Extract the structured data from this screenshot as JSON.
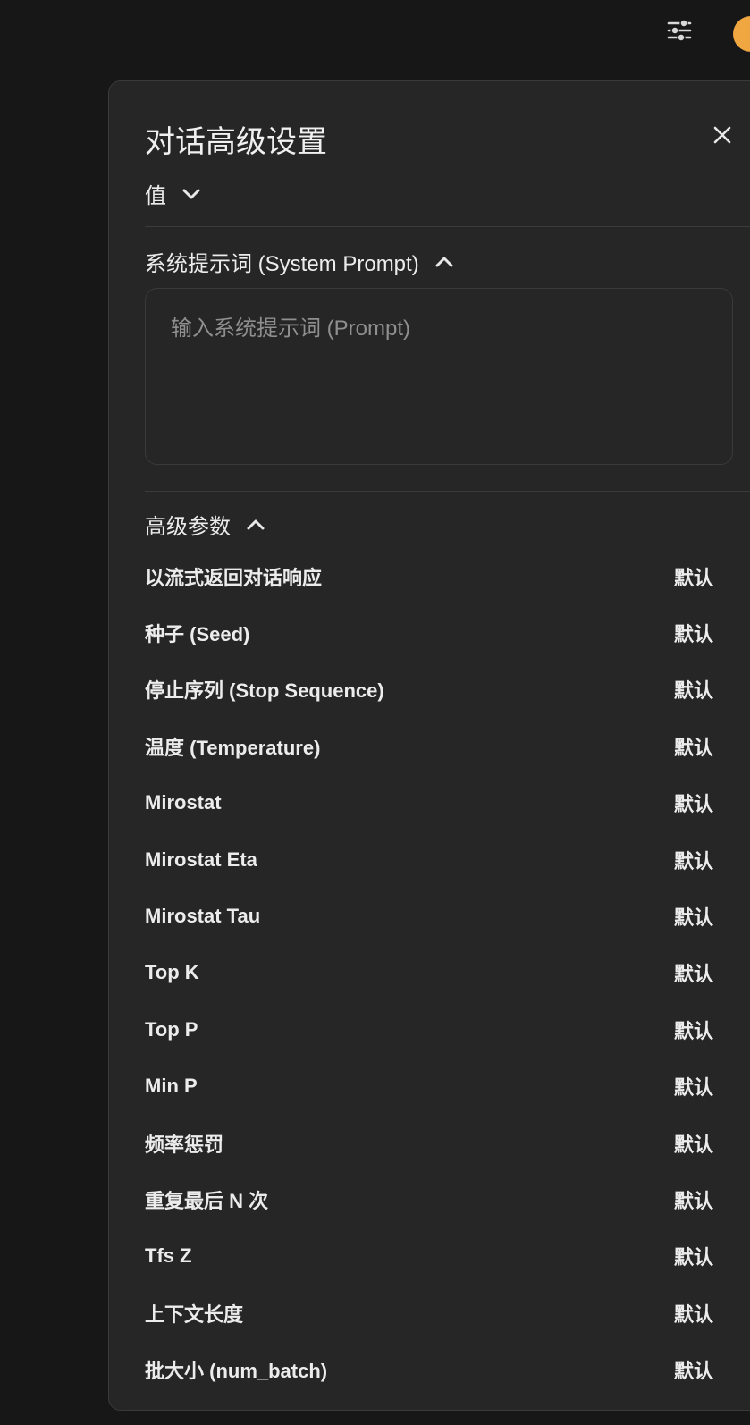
{
  "header": {
    "controls_icon": "sliders-icon",
    "avatar_color": "#f0a742"
  },
  "panel": {
    "title": "对话高级设置",
    "close_icon": "close-icon",
    "valves": {
      "label": "值",
      "icon": "chevron-down-icon"
    },
    "system_prompt": {
      "label": "系统提示词 (System Prompt)",
      "icon": "chevron-up-icon",
      "placeholder": "输入系统提示词 (Prompt)",
      "value": ""
    },
    "advanced": {
      "label": "高级参数",
      "icon": "chevron-up-icon",
      "params": [
        {
          "label": "以流式返回对话响应",
          "value": "默认"
        },
        {
          "label": "种子 (Seed)",
          "value": "默认"
        },
        {
          "label": "停止序列 (Stop Sequence)",
          "value": "默认"
        },
        {
          "label": "温度 (Temperature)",
          "value": "默认"
        },
        {
          "label": "Mirostat",
          "value": "默认"
        },
        {
          "label": "Mirostat Eta",
          "value": "默认"
        },
        {
          "label": "Mirostat Tau",
          "value": "默认"
        },
        {
          "label": "Top K",
          "value": "默认"
        },
        {
          "label": "Top P",
          "value": "默认"
        },
        {
          "label": "Min P",
          "value": "默认"
        },
        {
          "label": "频率惩罚",
          "value": "默认"
        },
        {
          "label": "重复最后 N 次",
          "value": "默认"
        },
        {
          "label": "Tfs Z",
          "value": "默认"
        },
        {
          "label": "上下文长度",
          "value": "默认"
        },
        {
          "label": "批大小 (num_batch)",
          "value": "默认"
        }
      ]
    }
  },
  "colors": {
    "background": "#171717",
    "panel": "#262626",
    "border": "#3a3a3a",
    "text": "#ececec",
    "placeholder": "#8f8f8f"
  }
}
